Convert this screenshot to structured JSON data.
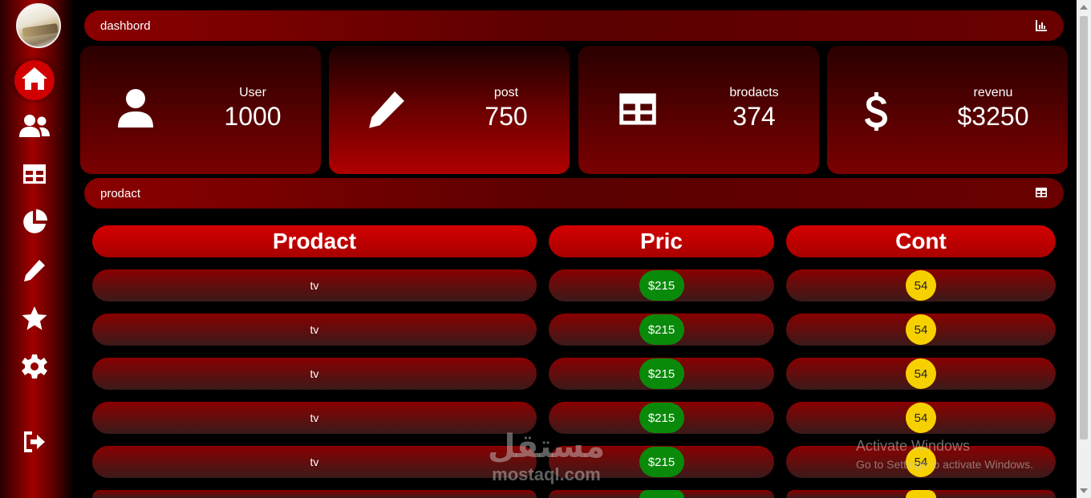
{
  "sidebar": {
    "items": [
      {
        "icon": "home-icon",
        "active": true
      },
      {
        "icon": "users-icon"
      },
      {
        "icon": "table-icon"
      },
      {
        "icon": "pie-chart-icon"
      },
      {
        "icon": "pencil-icon"
      },
      {
        "icon": "star-icon"
      },
      {
        "icon": "gear-icon"
      },
      {
        "icon": "logout-icon"
      }
    ]
  },
  "header": {
    "title": "dashbord",
    "icon": "bar-chart-icon"
  },
  "cards": [
    {
      "label": "User",
      "value": "1000",
      "icon": "user-icon"
    },
    {
      "label": "post",
      "value": "750",
      "icon": "pencil-icon"
    },
    {
      "label": "brodacts",
      "value": "374",
      "icon": "table-icon"
    },
    {
      "label": "revenu",
      "value": "$3250",
      "icon": "dollar-icon"
    }
  ],
  "section": {
    "title": "prodact",
    "icon": "table-icon"
  },
  "table": {
    "headers": [
      "Prodact",
      "Pric",
      "Cont"
    ],
    "rows": [
      [
        "tv",
        "$215",
        "54"
      ],
      [
        "tv",
        "$215",
        "54"
      ],
      [
        "tv",
        "$215",
        "54"
      ],
      [
        "tv",
        "$215",
        "54"
      ],
      [
        "tv",
        "$215",
        "54"
      ]
    ]
  },
  "watermarks": {
    "activate_title": "Activate Windows",
    "activate_sub": "Go to Settings to activate Windows.",
    "mostaql_ar": "مستقل",
    "mostaql_en": "mostaql.com"
  },
  "colors": {
    "accent": "#d00000",
    "green": "#0a8a0a",
    "yellow": "#f7d000",
    "background": "#000000"
  }
}
